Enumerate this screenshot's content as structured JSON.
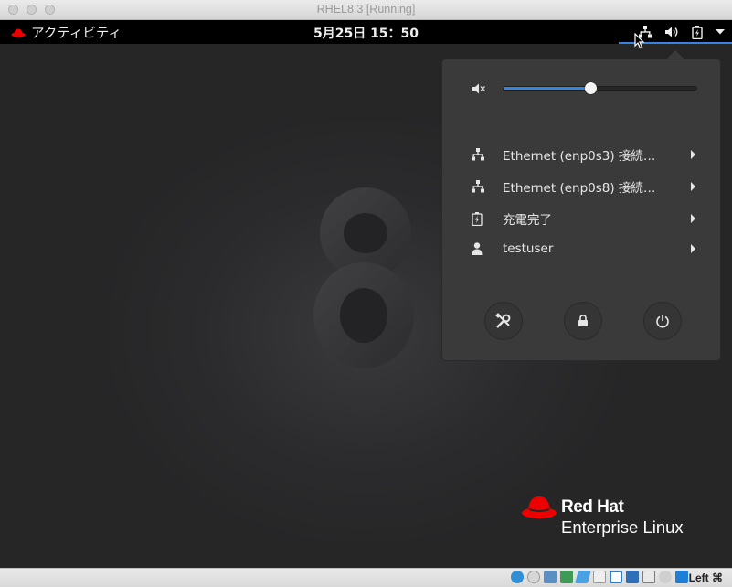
{
  "window": {
    "title": "RHEL8.3 [Running]"
  },
  "topbar": {
    "activities_label": "アクティビティ",
    "clock": "5月25日  15：50"
  },
  "system_menu": {
    "volume_level": 0.45,
    "items": [
      {
        "icon": "network-wired-icon",
        "label": "Ethernet (enp0s3) 接続…"
      },
      {
        "icon": "network-wired-icon",
        "label": "Ethernet (enp0s8) 接続…"
      },
      {
        "icon": "battery-charging-icon",
        "label": "充電完了"
      },
      {
        "icon": "user-icon",
        "label": "testuser"
      }
    ],
    "actions": [
      {
        "name": "settings-button",
        "icon": "tools-icon"
      },
      {
        "name": "lock-button",
        "icon": "lock-icon"
      },
      {
        "name": "power-button",
        "icon": "power-icon"
      }
    ]
  },
  "desktop": {
    "logo_line1": "Red Hat",
    "logo_line2": "Enterprise Linux",
    "version_mark": "8"
  },
  "statusbar": {
    "host_key": "Left ⌘"
  },
  "colors": {
    "accent": "#3584e4",
    "panel": "#3a3a3a",
    "topbar": "#000000",
    "redhat": "#ee0000"
  }
}
